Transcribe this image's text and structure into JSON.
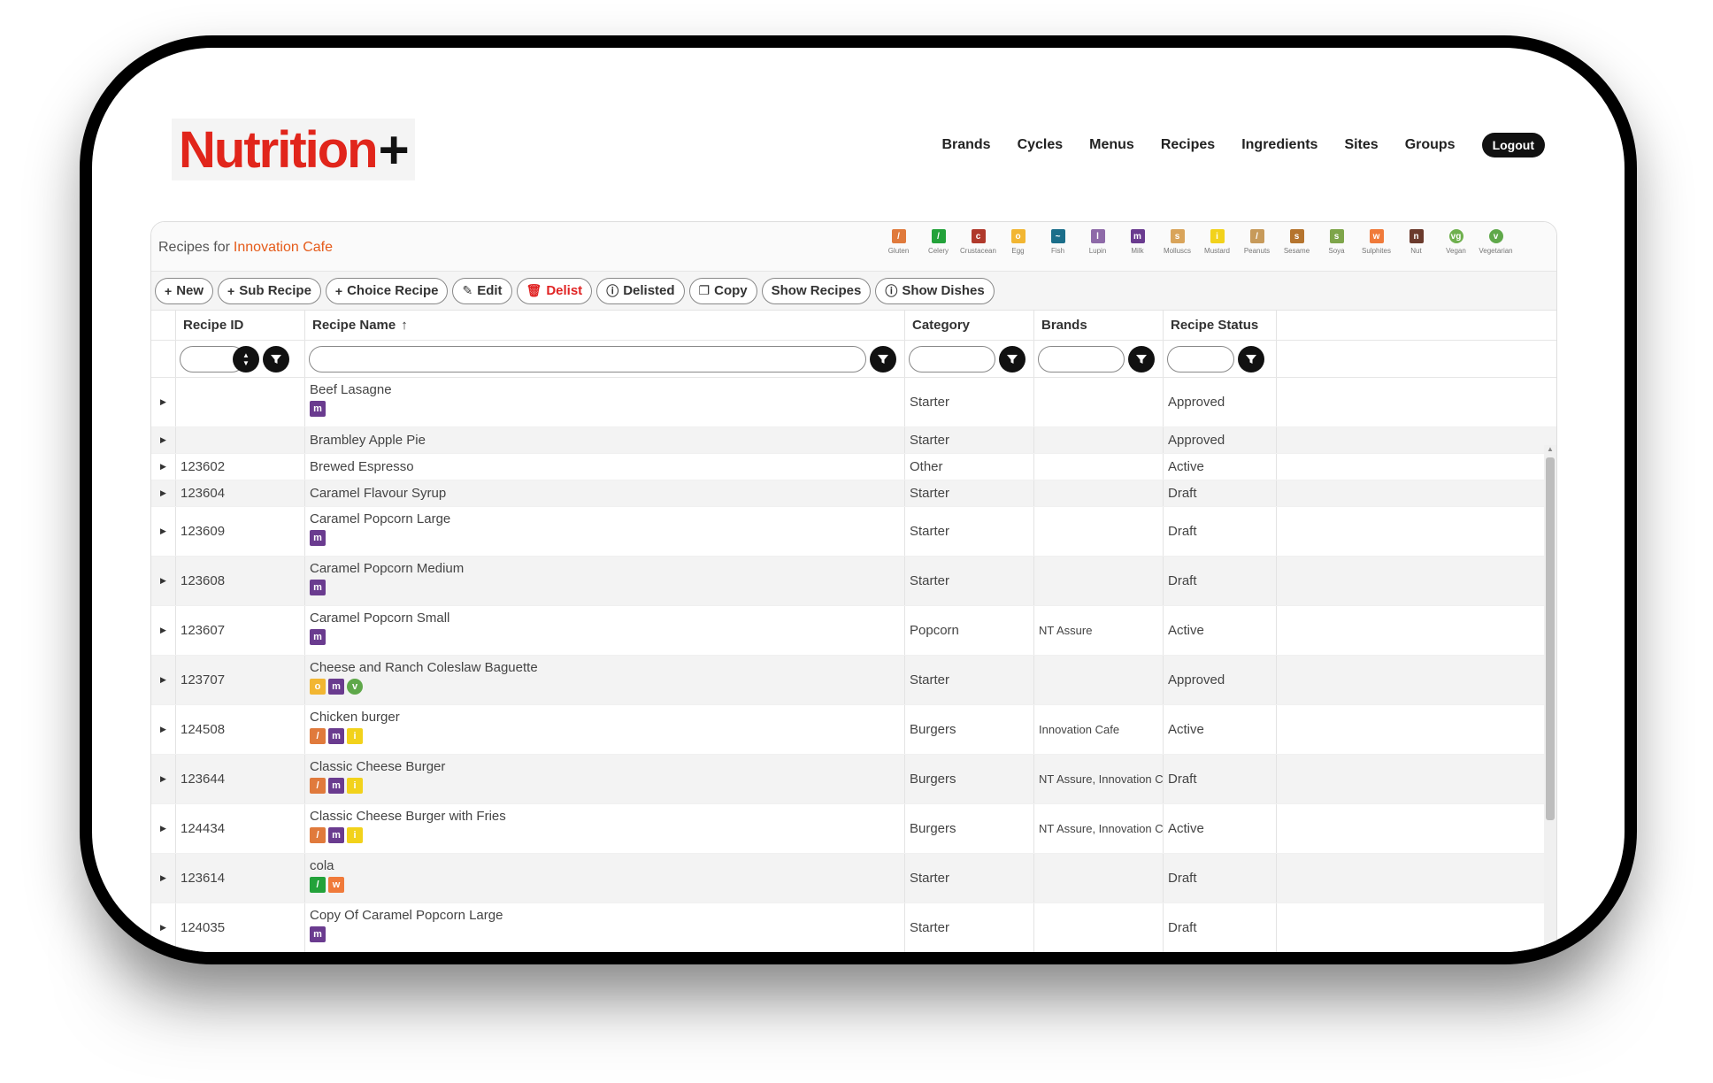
{
  "brand": {
    "logo_word": "Nutrition",
    "logo_plus": "+"
  },
  "nav": [
    {
      "label": "Brands"
    },
    {
      "label": "Cycles"
    },
    {
      "label": "Menus"
    },
    {
      "label": "Recipes"
    },
    {
      "label": "Ingredients"
    },
    {
      "label": "Sites"
    },
    {
      "label": "Groups"
    }
  ],
  "logout_label": "Logout",
  "panel": {
    "title_prefix": "Recipes for",
    "cafe": "Innovation Cafe"
  },
  "legend": [
    {
      "label": "Gluten",
      "color": "#e07a3c",
      "glyph": "/"
    },
    {
      "label": "Celery",
      "color": "#23a23a",
      "glyph": "/"
    },
    {
      "label": "Crustacean",
      "color": "#b0392b",
      "glyph": "c"
    },
    {
      "label": "Egg",
      "color": "#f2b632",
      "glyph": "o"
    },
    {
      "label": "Fish",
      "color": "#1b6e8a",
      "glyph": "~"
    },
    {
      "label": "Lupin",
      "color": "#8e6aa8",
      "glyph": "l"
    },
    {
      "label": "Milk",
      "color": "#6a3b8f",
      "glyph": "m"
    },
    {
      "label": "Molluscs",
      "color": "#d9a45a",
      "glyph": "s"
    },
    {
      "label": "Mustard",
      "color": "#f2d21b",
      "glyph": "i"
    },
    {
      "label": "Peanuts",
      "color": "#c79a5a",
      "glyph": "/"
    },
    {
      "label": "Sesame",
      "color": "#b5742e",
      "glyph": "s"
    },
    {
      "label": "Soya",
      "color": "#7ea54a",
      "glyph": "s"
    },
    {
      "label": "Sulphites",
      "color": "#f07a3a",
      "glyph": "w"
    },
    {
      "label": "Nut",
      "color": "#6b3a2c",
      "glyph": "n"
    },
    {
      "label": "Vegan",
      "color": "#6fb04e",
      "glyph": "vg",
      "round": true
    },
    {
      "label": "Vegetarian",
      "color": "#5fa84a",
      "glyph": "v",
      "round": true
    }
  ],
  "toolbar": [
    {
      "icon": "+",
      "label": "New",
      "name": "new-button"
    },
    {
      "icon": "+",
      "label": "Sub Recipe",
      "name": "sub-recipe-button"
    },
    {
      "icon": "+",
      "label": "Choice Recipe",
      "name": "choice-recipe-button"
    },
    {
      "icon": "✎",
      "label": "Edit",
      "name": "edit-button"
    },
    {
      "icon": "🗑",
      "label": "Delist",
      "name": "delist-button",
      "danger": true
    },
    {
      "icon": "ⓘ",
      "label": "Delisted",
      "name": "delisted-button"
    },
    {
      "icon": "❐",
      "label": "Copy",
      "name": "copy-button"
    },
    {
      "icon": "",
      "label": "Show Recipes",
      "name": "show-recipes-button"
    },
    {
      "icon": "ⓘ",
      "label": "Show Dishes",
      "name": "show-dishes-button"
    }
  ],
  "columns": {
    "id": "Recipe ID",
    "name": "Recipe Name",
    "name_sort": "↑",
    "category": "Category",
    "brands": "Brands",
    "status": "Recipe Status"
  },
  "rows": [
    {
      "id": "",
      "name": "Beef Lasagne",
      "allergens": [
        "Milk"
      ],
      "category": "Starter",
      "brands": "",
      "status": "Approved"
    },
    {
      "id": "",
      "name": "Brambley Apple Pie",
      "allergens": [],
      "category": "Starter",
      "brands": "",
      "status": "Approved"
    },
    {
      "id": "123602",
      "name": "Brewed Espresso",
      "allergens": [],
      "category": "Other",
      "brands": "",
      "status": "Active"
    },
    {
      "id": "123604",
      "name": "Caramel Flavour Syrup",
      "allergens": [],
      "category": "Starter",
      "brands": "",
      "status": "Draft"
    },
    {
      "id": "123609",
      "name": "Caramel Popcorn Large",
      "allergens": [
        "Milk"
      ],
      "category": "Starter",
      "brands": "",
      "status": "Draft"
    },
    {
      "id": "123608",
      "name": "Caramel Popcorn Medium",
      "allergens": [
        "Milk"
      ],
      "category": "Starter",
      "brands": "",
      "status": "Draft"
    },
    {
      "id": "123607",
      "name": "Caramel Popcorn Small",
      "allergens": [
        "Milk"
      ],
      "category": "Popcorn",
      "brands": "NT Assure",
      "status": "Active"
    },
    {
      "id": "123707",
      "name": "Cheese and Ranch Coleslaw Baguette",
      "allergens": [
        "Egg",
        "Milk",
        "Vegetarian"
      ],
      "category": "Starter",
      "brands": "",
      "status": "Approved"
    },
    {
      "id": "124508",
      "name": "Chicken burger",
      "allergens": [
        "Gluten",
        "Milk",
        "Mustard"
      ],
      "category": "Burgers",
      "brands": "Innovation Cafe",
      "status": "Active"
    },
    {
      "id": "123644",
      "name": "Classic Cheese Burger",
      "allergens": [
        "Gluten",
        "Milk",
        "Mustard"
      ],
      "category": "Burgers",
      "brands": "NT Assure, Innovation Cafe",
      "status": "Draft"
    },
    {
      "id": "124434",
      "name": "Classic Cheese Burger with Fries",
      "allergens": [
        "Gluten",
        "Milk",
        "Mustard"
      ],
      "category": "Burgers",
      "brands": "NT Assure, Innovation Cafe",
      "status": "Active"
    },
    {
      "id": "123614",
      "name": "cola",
      "allergens": [
        "Celery",
        "Sulphites"
      ],
      "category": "Starter",
      "brands": "",
      "status": "Draft"
    },
    {
      "id": "124035",
      "name": "Copy Of Caramel Popcorn Large",
      "allergens": [
        "Milk"
      ],
      "category": "Starter",
      "brands": "",
      "status": "Draft"
    }
  ]
}
